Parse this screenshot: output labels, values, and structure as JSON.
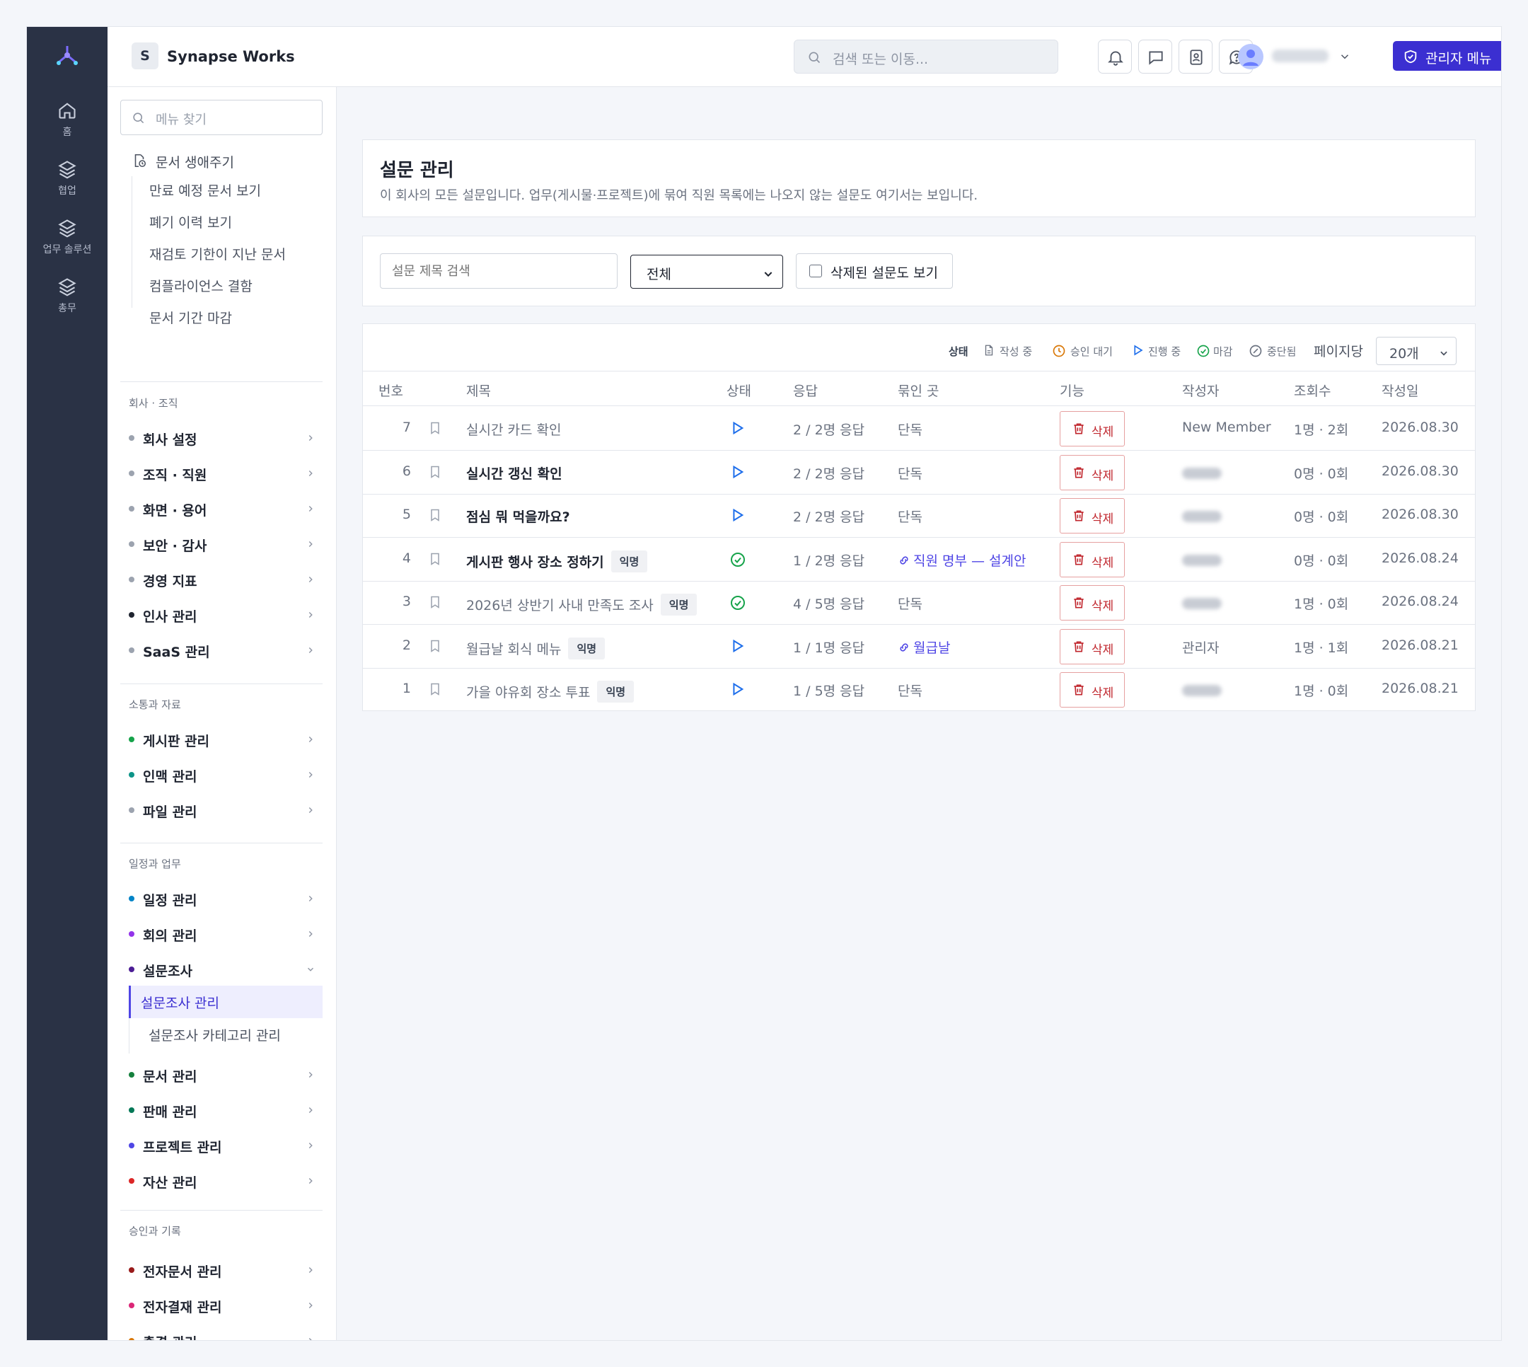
{
  "rail": {
    "items": [
      {
        "label": "홈",
        "icon": "home-icon"
      },
      {
        "label": "협업",
        "icon": "layers-icon"
      },
      {
        "label": "업무 솔루션",
        "icon": "layers-icon"
      },
      {
        "label": "총무",
        "icon": "layers-icon"
      }
    ]
  },
  "header": {
    "org_initial": "S",
    "org_name": "Synapse Works",
    "search_placeholder": "검색 또는 이동...",
    "admin_button": "관리자 메뉴"
  },
  "sidebar": {
    "search_placeholder": "메뉴 찾기",
    "lifecycle": {
      "label": "문서 생애주기",
      "items": [
        "만료 예정 문서 보기",
        "폐기 이력 보기",
        "재검토 기한이 지난 문서",
        "컴플라이언스 결함",
        "문서 기간 마감"
      ]
    },
    "sections": [
      {
        "title": "회사 · 조직",
        "items": [
          {
            "label": "회사 설정",
            "color": "#9ca3af"
          },
          {
            "label": "조직 · 직원",
            "color": "#9ca3af"
          },
          {
            "label": "화면 · 용어",
            "color": "#9ca3af"
          },
          {
            "label": "보안 · 감사",
            "color": "#9ca3af"
          },
          {
            "label": "경영 지표",
            "color": "#9ca3af"
          },
          {
            "label": "인사 관리",
            "color": "#1f2430"
          },
          {
            "label": "SaaS 관리",
            "color": "#9ca3af"
          }
        ]
      },
      {
        "title": "소통과 자료",
        "items": [
          {
            "label": "게시판 관리",
            "color": "#16a34a"
          },
          {
            "label": "인맥 관리",
            "color": "#0d9488"
          },
          {
            "label": "파일 관리",
            "color": "#9ca3af"
          }
        ]
      },
      {
        "title": "일정과 업무",
        "items": [
          {
            "label": "일정 관리",
            "color": "#0284c7"
          },
          {
            "label": "회의 관리",
            "color": "#9333ea"
          },
          {
            "label": "설문조사",
            "color": "#4c1d95"
          }
        ]
      },
      {
        "title": "",
        "items": [
          {
            "label": "문서 관리",
            "color": "#15803d"
          },
          {
            "label": "판매 관리",
            "color": "#047857"
          },
          {
            "label": "프로젝트 관리",
            "color": "#4f46e5"
          },
          {
            "label": "자산 관리",
            "color": "#dc2626"
          }
        ]
      },
      {
        "title": "승인과 기록",
        "items": [
          {
            "label": "전자문서 관리",
            "color": "#991b1b"
          },
          {
            "label": "전자결재 관리",
            "color": "#db2777"
          },
          {
            "label": "출결 관리",
            "color": "#d97706"
          }
        ]
      }
    ],
    "survey_sub": {
      "active": "설문조사 관리",
      "other": "설문조사 카테고리 관리"
    }
  },
  "main": {
    "title": "설문 관리",
    "description": "이 회사의 모든 설문입니다. 업무(게시물·프로젝트)에 묶여 직원 목록에는 나오지 않는 설문도 여기서는 보입니다.",
    "filter": {
      "search_placeholder": "설문 제목 검색",
      "select_value": "전체",
      "checkbox_label": "삭제된 설문도 보기"
    },
    "legend": {
      "title": "상태",
      "items": [
        "작성 중",
        "승인 대기",
        "진행 중",
        "마감",
        "중단됨"
      ],
      "per_page_label": "페이지당",
      "per_page_value": "20개"
    },
    "columns": [
      "번호",
      "제목",
      "상태",
      "응답",
      "묶인 곳",
      "기능",
      "작성자",
      "조회수",
      "작성일"
    ],
    "rows": [
      {
        "no": "7",
        "title": "실시간 카드 확인",
        "bold": false,
        "anon": "",
        "status": "running",
        "responses": "2 / 2명 응답",
        "bound": "단독",
        "link": false,
        "action": "삭제",
        "author": "New Member",
        "views": "1명 · 2회",
        "date": "2026.08.30"
      },
      {
        "no": "6",
        "title": "실시간 갱신 확인",
        "bold": true,
        "anon": "",
        "status": "running",
        "responses": "2 / 2명 응답",
        "bound": "단독",
        "link": false,
        "action": "삭제",
        "author": "",
        "views": "0명 · 0회",
        "date": "2026.08.30"
      },
      {
        "no": "5",
        "title": "점심 뭐 먹을까요?",
        "bold": true,
        "anon": "",
        "status": "running",
        "responses": "2 / 2명 응답",
        "bound": "단독",
        "link": false,
        "action": "삭제",
        "author": "",
        "views": "0명 · 0회",
        "date": "2026.08.30"
      },
      {
        "no": "4",
        "title": "게시판 행사 장소 정하기",
        "bold": true,
        "anon": "익명",
        "status": "closed",
        "responses": "1 / 2명 응답",
        "bound": "직원 명부 — 설계안",
        "link": true,
        "action": "삭제",
        "author": "",
        "views": "0명 · 0회",
        "date": "2026.08.24"
      },
      {
        "no": "3",
        "title": "2026년 상반기 사내 만족도 조사",
        "bold": false,
        "anon": "익명",
        "status": "closed",
        "responses": "4 / 5명 응답",
        "bound": "단독",
        "link": false,
        "action": "삭제",
        "author": "",
        "views": "1명 · 0회",
        "date": "2026.08.24"
      },
      {
        "no": "2",
        "title": "월급날 회식 메뉴",
        "bold": false,
        "anon": "익명",
        "status": "running",
        "responses": "1 / 1명 응답",
        "bound": "월급날",
        "link": true,
        "action": "삭제",
        "author": "관리자",
        "views": "1명 · 1회",
        "date": "2026.08.21"
      },
      {
        "no": "1",
        "title": "가을 야유회 장소 투표",
        "bold": false,
        "anon": "익명",
        "status": "running",
        "responses": "1 / 5명 응답",
        "bound": "단독",
        "link": false,
        "action": "삭제",
        "author": "",
        "views": "1명 · 0회",
        "date": "2026.08.21"
      }
    ]
  },
  "colors": {
    "rail": "#2a3245",
    "accent": "#3b2fd1",
    "danger": "#c0262d",
    "status_running": "#1f6feb",
    "status_closed": "#16a34a"
  }
}
